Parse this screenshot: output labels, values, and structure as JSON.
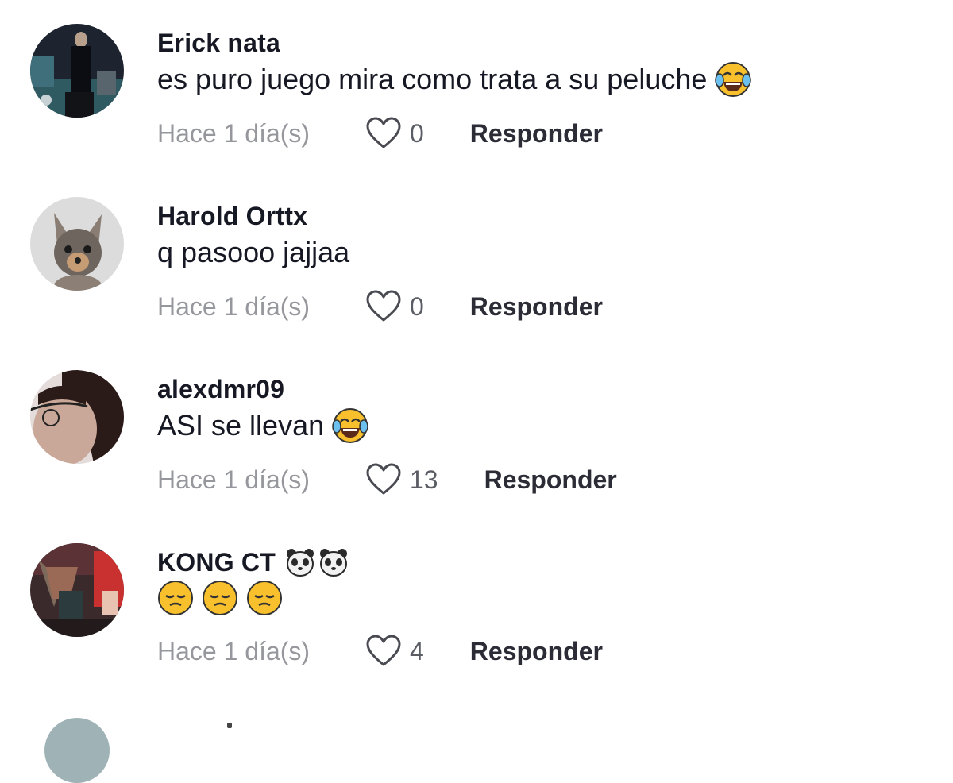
{
  "comments": [
    {
      "username": "Erick nata",
      "username_emojis": [],
      "text": "es puro juego mira como trata a su peluche",
      "text_emojis": [
        "face-with-tears-of-joy-emoji"
      ],
      "time": "Hace 1 día(s)",
      "likes": "0",
      "reply_label": "Responder"
    },
    {
      "username": "Harold Orttx",
      "username_emojis": [],
      "text": "q pasooo jajjaa",
      "text_emojis": [],
      "time": "Hace 1 día(s)",
      "likes": "0",
      "reply_label": "Responder"
    },
    {
      "username": "alexdmr09",
      "username_emojis": [],
      "text": "ASI se llevan",
      "text_emojis": [
        "face-with-tears-of-joy-emoji"
      ],
      "time": "Hace 1 día(s)",
      "likes": "13",
      "reply_label": "Responder"
    },
    {
      "username": "KONG CT",
      "username_emojis": [
        "panda-emoji",
        "panda-emoji"
      ],
      "text": "",
      "text_emojis": [
        "pensive-face-emoji",
        "pensive-face-emoji",
        "pensive-face-emoji"
      ],
      "time": "Hace 1 día(s)",
      "likes": "4",
      "reply_label": "Responder"
    }
  ],
  "icons": {
    "like": "heart-outline-icon"
  },
  "colors": {
    "text": "#161823",
    "muted": "#a0a1a7",
    "emoji_yellow": "#f7c02c"
  }
}
